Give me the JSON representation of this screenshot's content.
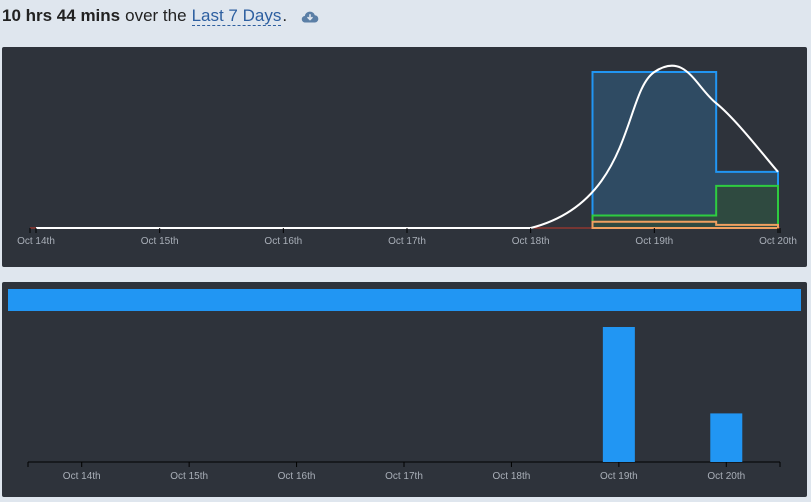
{
  "header": {
    "total": "10 hrs 44 mins",
    "mid": "over the",
    "range_label": "Last 7 Days",
    "period": ".",
    "download_icon": "cloud-download-icon"
  },
  "colors": {
    "panel_bg": "#2e333b",
    "blue": "#2196f3",
    "blue_fill": "#2f4b63",
    "green": "#2ecc40",
    "green_fill": "#2f4a40",
    "orange": "#f0a060",
    "red_line": "#c0392b",
    "curve": "#ffffff",
    "axis_text": "#a9afb8"
  },
  "chart_data": [
    {
      "type": "area",
      "x_labels": [
        "Oct 14th",
        "Oct 15th",
        "Oct 16th",
        "Oct 17th",
        "Oct 18th",
        "Oct 19th",
        "Oct 20th"
      ],
      "series": [
        {
          "color_key": "blue",
          "steps": [
            [
              0,
              0
            ],
            [
              4.5,
              1.0
            ],
            [
              5.5,
              0.36
            ],
            [
              6,
              0.36
            ]
          ]
        },
        {
          "color_key": "green",
          "steps": [
            [
              0,
              0
            ],
            [
              4.5,
              0.08
            ],
            [
              5.5,
              0.27
            ],
            [
              6,
              0.27
            ]
          ]
        },
        {
          "color_key": "orange",
          "steps": [
            [
              0,
              0
            ],
            [
              4.5,
              0.04
            ],
            [
              5.5,
              0.02
            ],
            [
              6,
              0.02
            ]
          ]
        }
      ],
      "curve": [
        [
          0,
          0
        ],
        [
          4,
          0
        ],
        [
          5,
          1.0
        ],
        [
          5.5,
          0.8
        ],
        [
          6,
          0.36
        ]
      ]
    },
    {
      "type": "bar",
      "categories": [
        "Oct 14th",
        "Oct 15th",
        "Oct 16th",
        "Oct 17th",
        "Oct 18th",
        "Oct 19th",
        "Oct 20th"
      ],
      "values": [
        0,
        0,
        0,
        0,
        0,
        1.0,
        0.36
      ],
      "top_bar": 1.0
    }
  ]
}
